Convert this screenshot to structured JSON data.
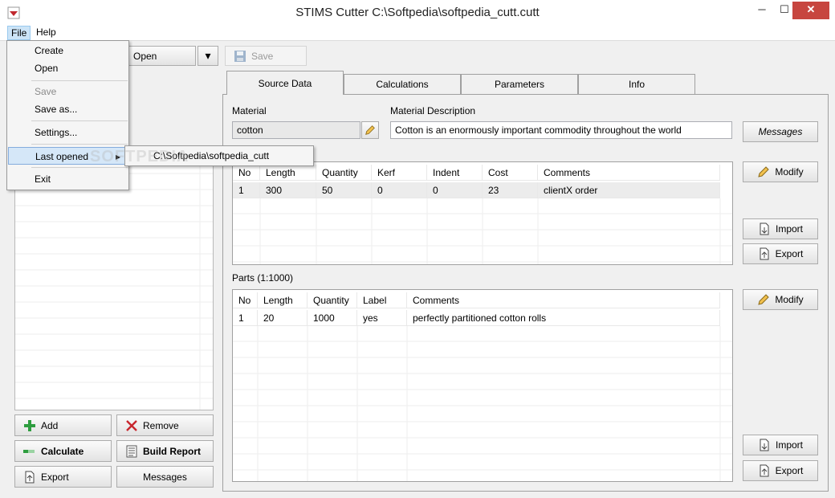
{
  "window": {
    "title": "STIMS Cutter  C:\\Softpedia\\softpedia_cutt.cutt",
    "min": "─",
    "max": "☐",
    "close": "✕"
  },
  "menubar": {
    "file": "File",
    "help": "Help"
  },
  "toolbar": {
    "open": "Open",
    "open_more": "▾",
    "save": "Save"
  },
  "file_menu": {
    "items": [
      "Create",
      "Open",
      "Save",
      "Save as...",
      "Settings...",
      "Last opened",
      "Exit"
    ],
    "submenu_arrow": "▸",
    "recent": "C:\\Softpedia\\softpedia_cutt"
  },
  "watermark": "SOFTPEDIA",
  "tabs": [
    "Source Data",
    "Calculations",
    "Parameters",
    "Info"
  ],
  "material": {
    "label": "Material",
    "value": "cotton",
    "desc_label": "Material Description",
    "desc_value": "Cotton is an enormously important commodity throughout the world",
    "messages_button": "Messages"
  },
  "stock": {
    "headers": [
      "No",
      "Length",
      "Quantity",
      "Kerf",
      "Indent",
      "Cost",
      "Comments"
    ],
    "rows": [
      [
        "1",
        "300",
        "50",
        "0",
        "0",
        "23",
        "clientX order"
      ]
    ]
  },
  "parts": {
    "label": "Parts (1:1000)",
    "headers": [
      "No",
      "Length",
      "Quantity",
      "Label",
      "Comments"
    ],
    "rows": [
      [
        "1",
        "20",
        "1000",
        "yes",
        "perfectly partitioned cotton rolls"
      ]
    ]
  },
  "side_buttons": {
    "modify": "Modify",
    "import": "Import",
    "export": "Export"
  },
  "left_buttons": {
    "add": "Add",
    "remove": "Remove",
    "calculate": "Calculate",
    "build_report": "Build Report",
    "export": "Export",
    "messages": "Messages"
  },
  "colors": {
    "accent_blue": "#cce4f7",
    "close_red": "#c7463f",
    "add_green": "#2e9d3f",
    "remove_red": "#c8262d"
  }
}
